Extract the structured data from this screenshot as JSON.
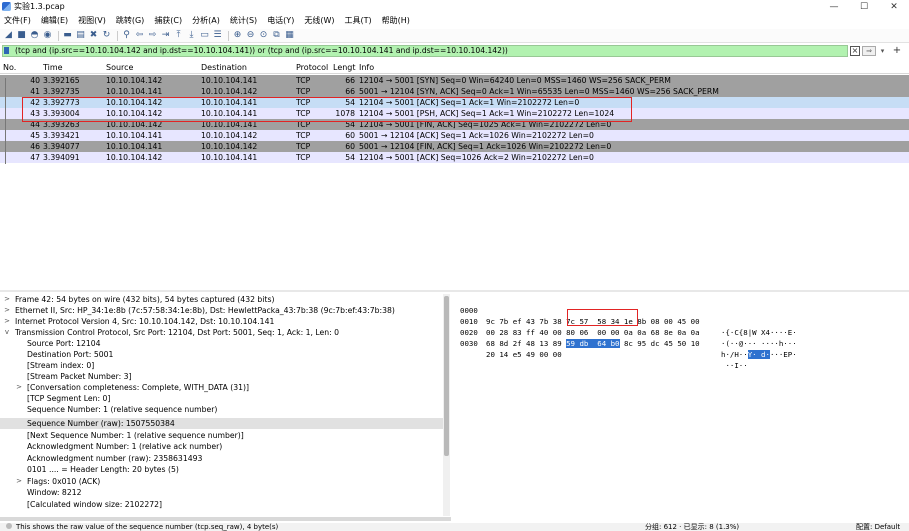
{
  "window": {
    "title": "实验1.3.pcap",
    "min": "—",
    "max": "☐",
    "close": "✕"
  },
  "menu": [
    "文件(F)",
    "编辑(E)",
    "视图(V)",
    "跳转(G)",
    "捕获(C)",
    "分析(A)",
    "统计(S)",
    "电话(Y)",
    "无线(W)",
    "工具(T)",
    "帮助(H)"
  ],
  "filter": {
    "value": "(tcp and (ip.src==10.10.104.142 and ip.dst==10.10.104.141)) or (tcp and (ip.src==10.10.104.141 and ip.dst==10.10.104.142))"
  },
  "columns": {
    "no": "No.",
    "time": "Time",
    "source": "Source",
    "destination": "Destination",
    "protocol": "Protocol",
    "length": "Lengt",
    "info": "Info"
  },
  "packets": [
    {
      "no": "40",
      "time": "3.392165",
      "src": "10.10.104.142",
      "dst": "10.10.104.141",
      "proto": "TCP",
      "len": "66",
      "info": "12104 → 5001 [SYN] Seq=0 Win=64240 Len=0 MSS=1460 WS=256 SACK_PERM"
    },
    {
      "no": "41",
      "time": "3.392735",
      "src": "10.10.104.141",
      "dst": "10.10.104.142",
      "proto": "TCP",
      "len": "66",
      "info": "5001 → 12104 [SYN, ACK] Seq=0 Ack=1 Win=65535 Len=0 MSS=1460 WS=256 SACK_PERM"
    },
    {
      "no": "42",
      "time": "3.392773",
      "src": "10.10.104.142",
      "dst": "10.10.104.141",
      "proto": "TCP",
      "len": "54",
      "info": "12104 → 5001 [ACK] Seq=1 Ack=1 Win=2102272 Len=0"
    },
    {
      "no": "43",
      "time": "3.393004",
      "src": "10.10.104.142",
      "dst": "10.10.104.141",
      "proto": "TCP",
      "len": "1078",
      "info": "12104 → 5001 [PSH, ACK] Seq=1 Ack=1 Win=2102272 Len=1024"
    },
    {
      "no": "44",
      "time": "3.393263",
      "src": "10.10.104.142",
      "dst": "10.10.104.141",
      "proto": "TCP",
      "len": "54",
      "info": "12104 → 5001 [FIN, ACK] Seq=1025 Ack=1 Win=2102272 Len=0"
    },
    {
      "no": "45",
      "time": "3.393421",
      "src": "10.10.104.141",
      "dst": "10.10.104.142",
      "proto": "TCP",
      "len": "60",
      "info": "5001 → 12104 [ACK] Seq=1 Ack=1026 Win=2102272 Len=0"
    },
    {
      "no": "46",
      "time": "3.394077",
      "src": "10.10.104.141",
      "dst": "10.10.104.142",
      "proto": "TCP",
      "len": "60",
      "info": "5001 → 12104 [FIN, ACK] Seq=1 Ack=1026 Win=2102272 Len=0"
    },
    {
      "no": "47",
      "time": "3.394091",
      "src": "10.10.104.142",
      "dst": "10.10.104.141",
      "proto": "TCP",
      "len": "54",
      "info": "12104 → 5001 [ACK] Seq=1026 Ack=2 Win=2102272 Len=0"
    }
  ],
  "details": [
    {
      "tw": ">",
      "text": "Frame 42: 54 bytes on wire (432 bits), 54 bytes captured (432 bits)"
    },
    {
      "tw": ">",
      "text": "Ethernet II, Src: HP_34:1e:8b (7c:57:58:34:1e:8b), Dst: HewlettPacka_43:7b:38 (9c:7b:ef:43:7b:38)"
    },
    {
      "tw": ">",
      "text": "Internet Protocol Version 4, Src: 10.10.104.142, Dst: 10.10.104.141"
    },
    {
      "tw": "v",
      "text": "Transmission Control Protocol, Src Port: 12104, Dst Port: 5001, Seq: 1, Ack: 1, Len: 0"
    },
    {
      "tw": "",
      "text": "Source Port: 12104"
    },
    {
      "tw": "",
      "text": "Destination Port: 5001"
    },
    {
      "tw": "",
      "text": "[Stream index: 0]"
    },
    {
      "tw": "",
      "text": "[Stream Packet Number: 3]"
    },
    {
      "tw": ">",
      "text": "[Conversation completeness: Complete, WITH_DATA (31)]"
    },
    {
      "tw": "",
      "text": "[TCP Segment Len: 0]"
    },
    {
      "tw": "",
      "text": "Sequence Number: 1    (relative sequence number)"
    },
    {
      "tw": "",
      "text": "Sequence Number (raw): 1507550384"
    },
    {
      "tw": "",
      "text": "[Next Sequence Number: 1    (relative sequence number)]"
    },
    {
      "tw": "",
      "text": "Acknowledgment Number: 1    (relative ack number)"
    },
    {
      "tw": "",
      "text": "Acknowledgment number (raw): 2358631493"
    },
    {
      "tw": "",
      "text": "0101 .... = Header Length: 20 bytes (5)"
    },
    {
      "tw": ">",
      "text": "Flags: 0x010 (ACK)"
    },
    {
      "tw": "",
      "text": "Window: 8212"
    },
    {
      "tw": "",
      "text": "[Calculated window size: 2102272]"
    }
  ],
  "bytes": [
    {
      "offset": "0000",
      "hex_a": "9c 7b ef 43 7b 38 7c 57  58 34 1e 8b 08 00 45 00",
      "hex_hl": "",
      "hex_b": "",
      "ascii_a": "·{·C{8|W X4····E·",
      "ascii_hl": "",
      "ascii_b": ""
    },
    {
      "offset": "0010",
      "hex_a": "00 28 83 ff 40 00 80 06  00 00 0a 0a 68 8e 0a 0a",
      "hex_hl": "",
      "hex_b": "",
      "ascii_a": "·(··@··· ····h···",
      "ascii_hl": "",
      "ascii_b": ""
    },
    {
      "offset": "0020",
      "hex_a": "68 8d 2f 48 13 89 ",
      "hex_hl": "59 db  64 b0",
      "hex_b": " 8c 95 dc 45 50 10",
      "ascii_a": "h·/H··",
      "ascii_hl": "Y· d·",
      "ascii_b": "···EP·"
    },
    {
      "offset": "0030",
      "hex_a": "20 14 e5 49 00 00",
      "hex_hl": "",
      "hex_b": "",
      "ascii_a": " ··I··",
      "ascii_hl": "",
      "ascii_b": ""
    }
  ],
  "status": {
    "message": "This shows the raw value of the sequence number (tcp.seq_raw), 4 byte(s)",
    "packets": "分组: 612 · 已显示: 8 (1.3%)",
    "profile": "配置: Default"
  }
}
